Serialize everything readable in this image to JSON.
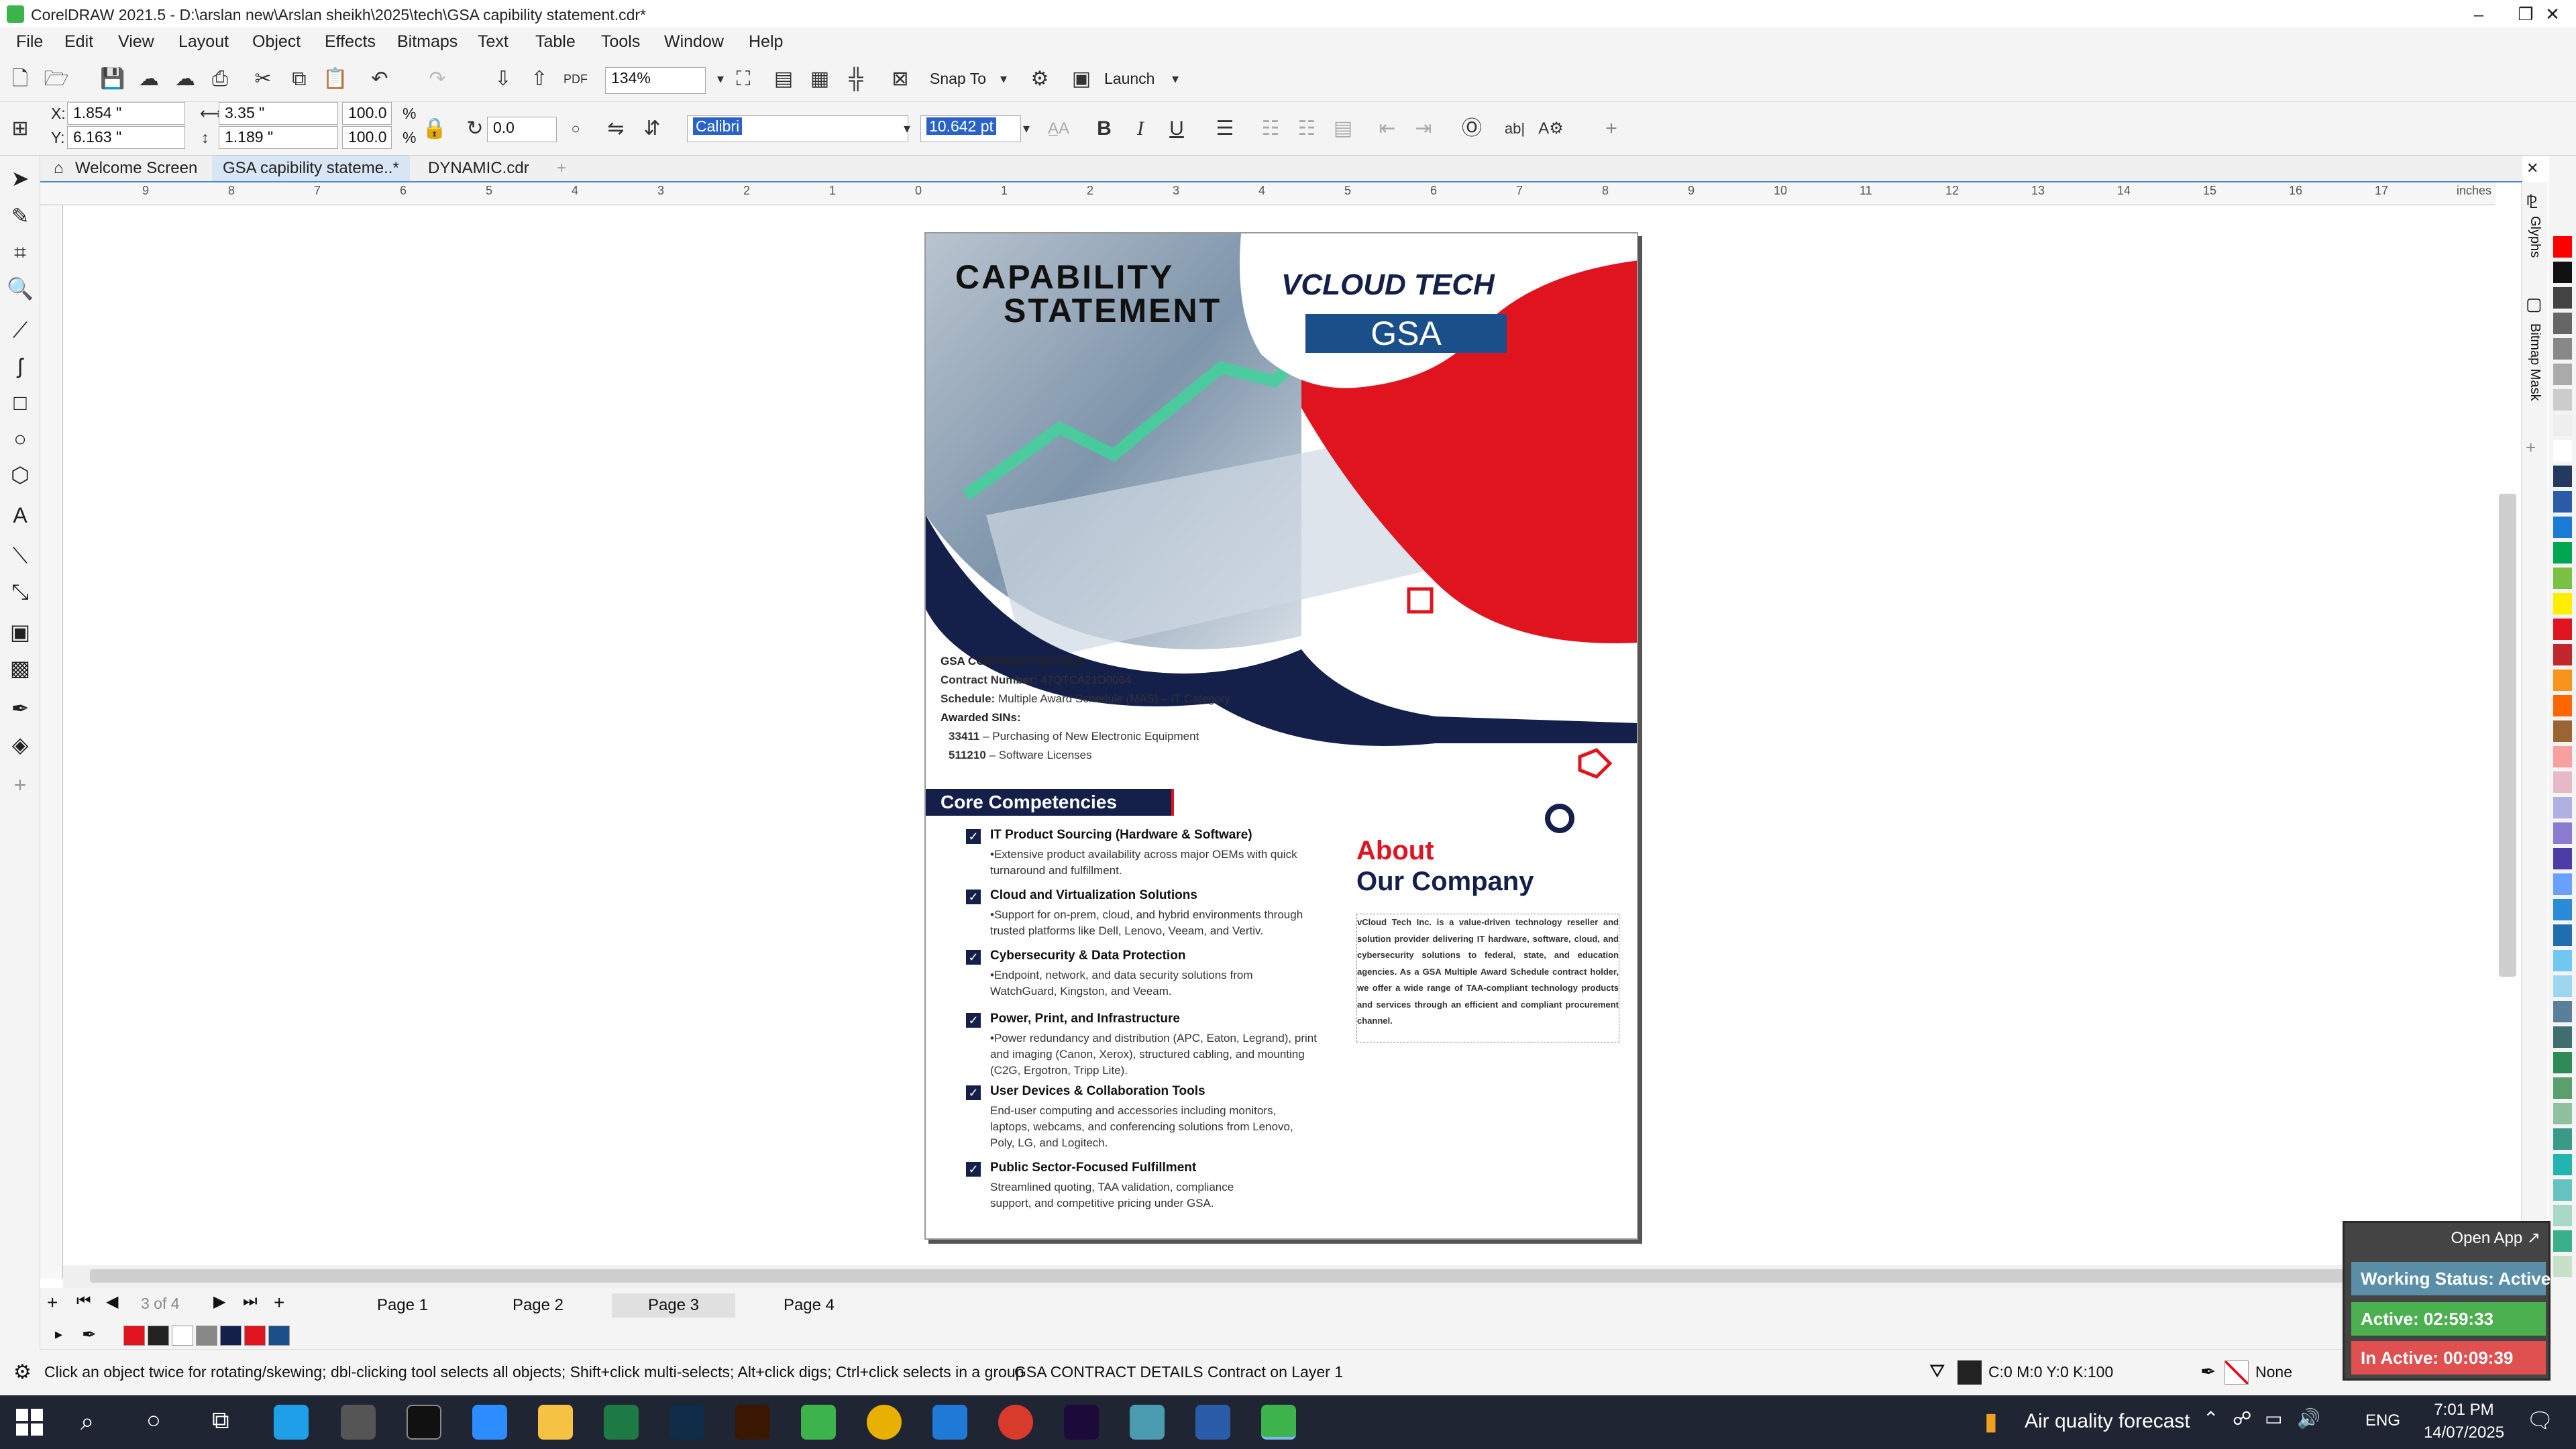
{
  "window": {
    "title": "CorelDRAW 2021.5 - D:\\arslan new\\Arslan sheikh\\2025\\tech\\GSA   capibility statement.cdr*",
    "minimize": "–",
    "restore": "❐",
    "close": "✕"
  },
  "menu": [
    "File",
    "Edit",
    "View",
    "Layout",
    "Object",
    "Effects",
    "Bitmaps",
    "Text",
    "Table",
    "Tools",
    "Window",
    "Help"
  ],
  "toolbar": {
    "zoom": "134%",
    "snap_to": "Snap To",
    "launch": "Launch"
  },
  "property_bar": {
    "x_label": "X:",
    "x": "1.854 \"",
    "y_label": "Y:",
    "y": "6.163 \"",
    "width": "3.35 \"",
    "height": "1.189 \"",
    "scale_w": "100.0",
    "scale_h": "100.0",
    "pct": "%",
    "rotation": "0.0",
    "font_name": "Calibri",
    "font_size": "10.642 pt",
    "bold": "B",
    "italic": "I",
    "underline": "U"
  },
  "doc_tabs": [
    "Welcome Screen",
    "GSA   capibility stateme..*",
    "DYNAMIC.cdr"
  ],
  "ruler": {
    "h_ticks": [
      "9",
      "8",
      "7",
      "6",
      "5",
      "4",
      "3",
      "2",
      "1",
      "0",
      "1",
      "2",
      "3",
      "4",
      "5",
      "6",
      "7",
      "8",
      "9",
      "10",
      "11",
      "12",
      "13",
      "14",
      "15",
      "16",
      "17"
    ],
    "unit": "inches"
  },
  "document": {
    "heading_line1": "CAPABILITY",
    "heading_line2": "STATEMENT",
    "logo_text": "VCLOUD TECH",
    "logo_badge": "GSA",
    "gsa_title": "GSA CONTRACT DETAILS",
    "contract_label": "Contract Number:",
    "contract_value": "47QTCA21D0064",
    "schedule_label": "Schedule:",
    "schedule_value": "Multiple Award Schedule (MAS) – IT Category",
    "sins_label": "Awarded SINs:",
    "sin1_code": "33411",
    "sin1_text": "– Purchasing of New Electronic Equipment",
    "sin2_code": "511210",
    "sin2_text": "– Software Licenses",
    "core_title": "Core Competencies",
    "competencies": [
      {
        "title": "IT Product Sourcing (Hardware & Software)",
        "desc": "•Extensive product availability across major OEMs with quick turnaround and fulfillment."
      },
      {
        "title": "Cloud and Virtualization Solutions",
        "desc": "•Support for on-prem, cloud, and hybrid environments through trusted platforms like Dell, Lenovo, Veeam, and Vertiv."
      },
      {
        "title": "Cybersecurity & Data Protection",
        "desc": "•Endpoint, network, and data security solutions from WatchGuard, Kingston, and Veeam."
      },
      {
        "title": "Power, Print, and Infrastructure",
        "desc": "•Power redundancy and distribution (APC, Eaton, Legrand), print and imaging (Canon, Xerox), structured cabling, and mounting (C2G, Ergotron, Tripp Lite)."
      },
      {
        "title": "User Devices & Collaboration Tools",
        "desc": "End-user computing and accessories including monitors, laptops, webcams, and conferencing solutions from Lenovo, Poly, LG, and Logitech."
      },
      {
        "title": "Public Sector-Focused Fulfillment",
        "desc": "Streamlined quoting, TAA validation, compliance support, and competitive pricing under GSA."
      }
    ],
    "about_line1": "About",
    "about_line2": "Our Company",
    "about_text": "vCloud Tech Inc. is a value-driven technology reseller and solution provider delivering IT hardware, software, cloud, and cybersecurity solutions to federal, state, and education agencies. As a GSA Multiple Award Schedule contract holder, we offer a wide range of TAA-compliant technology products and services through an efficient and compliant procurement channel."
  },
  "docker_tabs": [
    "Glyphs",
    "Bitmap Mask"
  ],
  "page_nav": {
    "counter": "3 of 4",
    "pages": [
      "Page 1",
      "Page 2",
      "Page 3",
      "Page 4"
    ],
    "active": "Page 3"
  },
  "status": {
    "hint": "Click an object twice for rotating/skewing; dbl-clicking tool selects all objects; Shift+click multi-selects; Alt+click digs; Ctrl+click selects in a group",
    "selection": "GSA CONTRACT DETAILS Contract  on Layer 1",
    "fill": "C:0 M:0 Y:0 K:100",
    "outline": "None"
  },
  "tracker": {
    "open_app": "Open App ↗",
    "working": "Working Status: Active",
    "active": "Active: 02:59:33",
    "inactive": "In Active: 00:09:39"
  },
  "taskbar": {
    "weather": "Air quality forecast",
    "lang": "ENG",
    "time": "7:01 PM",
    "date": "14/07/2025"
  },
  "colors": {
    "brand_red": "#e0141e",
    "brand_navy": "#14204a",
    "gsa_blue": "#1a4f8a",
    "tracker_green": "#4caf50",
    "tracker_red": "#e05050"
  }
}
